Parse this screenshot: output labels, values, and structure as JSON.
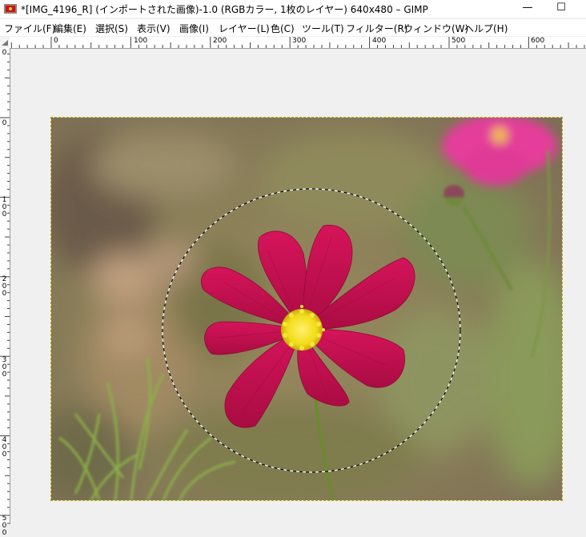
{
  "window": {
    "title": "*[IMG_4196_R] (インポートされた画像)-1.0 (RGBカラー, 1枚のレイヤー) 640x480 – GIMP",
    "minimize_glyph": "—",
    "maximize_glyph": "☐"
  },
  "menubar": {
    "items": [
      "ファイル(F)",
      "編集(E)",
      "選択(S)",
      "表示(V)",
      "画像(I)",
      "レイヤー(L)",
      "色(C)",
      "ツール(T)",
      "フィルター(R)",
      "ウィンドウ(W)",
      "ヘルプ(H)"
    ]
  },
  "ruler": {
    "horizontal_labels": [
      "0",
      "100",
      "200",
      "300",
      "400",
      "500",
      "600"
    ],
    "vertical_labels": [
      "0",
      "100",
      "200",
      "300",
      "400",
      "500"
    ]
  },
  "canvas": {
    "image_width": 640,
    "image_height": 480,
    "selection": "ellipse",
    "colors": {
      "petal": "#c8104f",
      "petal_dark": "#8e0a35",
      "center": "#f2dc1a",
      "background_green": "#7a8a4a",
      "pink_flower": "#e43c9a"
    }
  }
}
